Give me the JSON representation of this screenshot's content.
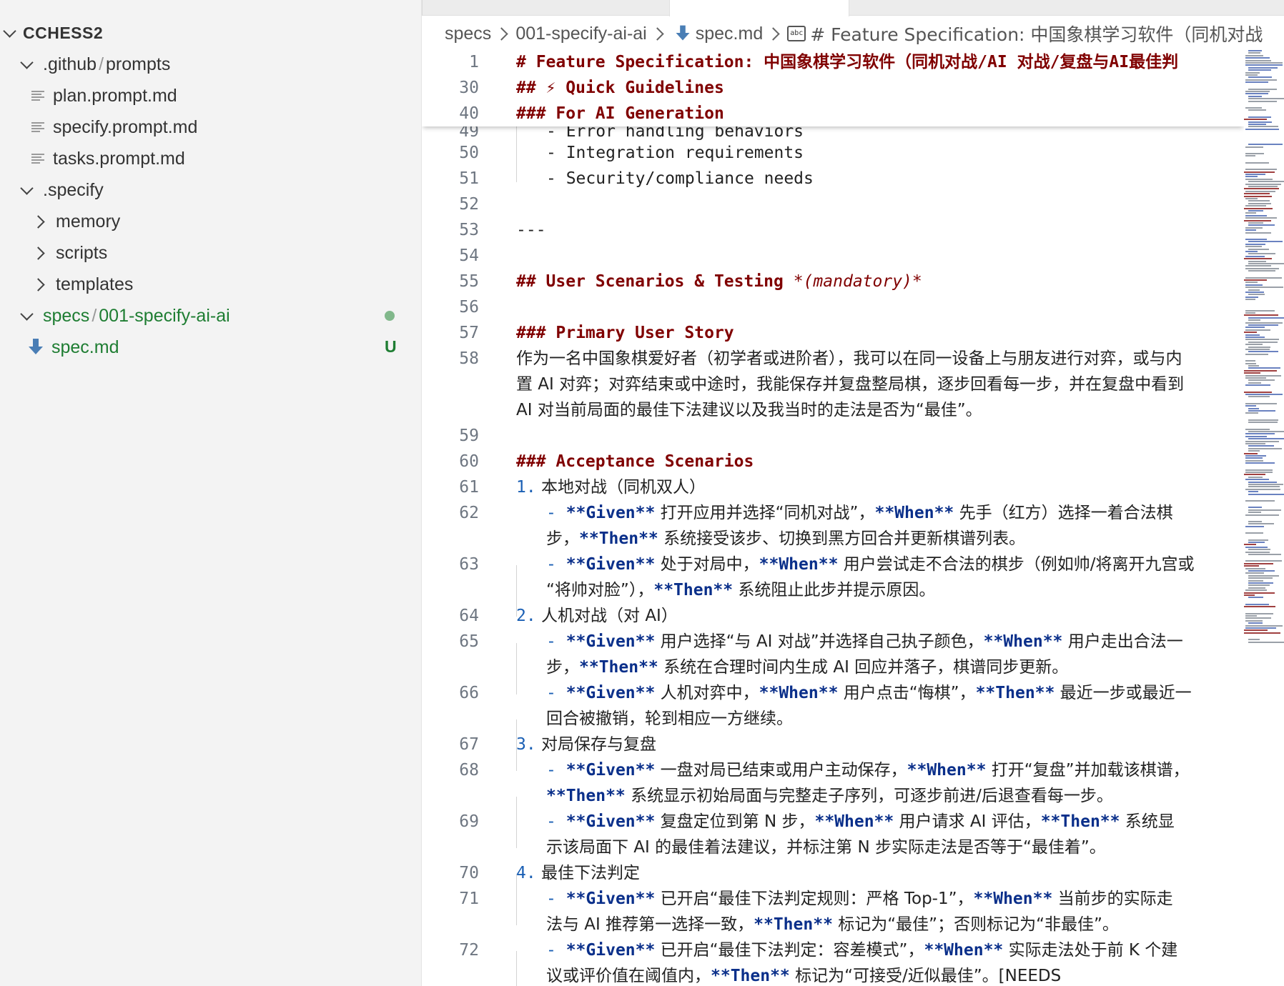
{
  "explorer": {
    "root": "CCHESS2",
    "items": [
      {
        "label": ".github",
        "sep": "/",
        "label2": "prompts"
      },
      {
        "label": "plan.prompt.md"
      },
      {
        "label": "specify.prompt.md"
      },
      {
        "label": "tasks.prompt.md"
      },
      {
        "label": ".specify"
      },
      {
        "label": "memory"
      },
      {
        "label": "scripts"
      },
      {
        "label": "templates"
      },
      {
        "label": "specs",
        "sep": "/",
        "label2": "001-specify-ai-ai"
      },
      {
        "label": "spec.md",
        "badge": "U"
      }
    ]
  },
  "breadcrumb": {
    "p1": "specs",
    "p2": "001-specify-ai-ai",
    "p3": "spec.md",
    "p4_icon_text": "abc",
    "p4": "# Feature Specification: 中国象棋学习软件（同机对战"
  },
  "sticky": [
    {
      "n": "1",
      "t": "# Feature Specification: 中国象棋学习软件（同机对战/AI 对战/复盘与AI最佳判"
    },
    {
      "n": "30",
      "a": "## ",
      "b": "⚡",
      "c": " Quick Guidelines"
    },
    {
      "n": "40",
      "t": "### For AI Generation"
    }
  ],
  "lines": {
    "l49": {
      "n": "49",
      "t": "- Error handling behaviors"
    },
    "l50": {
      "n": "50",
      "t": "- Integration requirements"
    },
    "l51": {
      "n": "51",
      "t": "- Security/compliance needs"
    },
    "l52": {
      "n": "52"
    },
    "l53": {
      "n": "53",
      "t": "---"
    },
    "l54": {
      "n": "54"
    },
    "l55": {
      "n": "55",
      "h": "## User Scenarios & Testing ",
      "it": "*(mandatory)*"
    },
    "l56": {
      "n": "56"
    },
    "l57": {
      "n": "57",
      "h": "### Primary User Story"
    },
    "l58": {
      "n": "58",
      "w1": "作为一名中国象棋爱好者（初学者或进阶者），我可以在同一设备上与朋友进行对弈，或与内",
      "w2": "置 AI 对弈；对弈结束或中途时，我能保存并复盘整局棋，逐步回看每一步，并在复盘中看到",
      "w3": "AI 对当前局面的最佳下法建议以及我当时的走法是否为“最佳”。"
    },
    "l59": {
      "n": "59"
    },
    "l60": {
      "n": "60",
      "h": "### Acceptance Scenarios"
    },
    "l61": {
      "n": "61",
      "num": "1.",
      "t": " 本地对战（同机双人）"
    },
    "l62": {
      "n": "62",
      "g": "**Given**",
      "a": " 打开应用并选择“同机对战”，",
      "w": "**When**",
      "b": " 先手（红方）选择一着合法棋",
      "c": "步，",
      "th": "**Then**",
      "d": " 系统接受该步、切换到黑方回合并更新棋谱列表。"
    },
    "l63": {
      "n": "63",
      "g": "**Given**",
      "a": " 处于对局中，",
      "w": "**When**",
      "b": " 用户尝试走不合法的棋步（例如帅/将离开九宫或",
      "c": "“将帅对脸”），",
      "th": "**Then**",
      "d": " 系统阻止此步并提示原因。"
    },
    "l64": {
      "n": "64",
      "num": "2.",
      "t": " 人机对战（对 AI）"
    },
    "l65": {
      "n": "65",
      "g": "**Given**",
      "a": " 用户选择“与 AI 对战”并选择自己执子颜色，",
      "w": "**When**",
      "b": " 用户走出合法一",
      "c": "步，",
      "th": "**Then**",
      "d": " 系统在合理时间内生成 AI 回应并落子，棋谱同步更新。"
    },
    "l66": {
      "n": "66",
      "g": "**Given**",
      "a": " 人机对弈中，",
      "w": "**When**",
      "b": " 用户点击“悔棋”，",
      "th": "**Then**",
      "d": " 最近一步或最近一",
      "c": "回合被撤销，轮到相应一方继续。"
    },
    "l67": {
      "n": "67",
      "num": "3.",
      "t": " 对局保存与复盘"
    },
    "l68": {
      "n": "68",
      "g": "**Given**",
      "a": " 一盘对局已结束或用户主动保存，",
      "w": "**When**",
      "b": " 打开“复盘”并加载该棋谱，",
      "th": "**Then**",
      "d": " 系统显示初始局面与完整走子序列，可逐步前进/后退查看每一步。"
    },
    "l69": {
      "n": "69",
      "g": "**Given**",
      "a": " 复盘定位到第 N 步，",
      "w": "**When**",
      "b": " 用户请求 AI 评估，",
      "th": "**Then**",
      "d": " 系统显",
      "c": "示该局面下 AI 的最佳着法建议，并标注第 N 步实际走法是否等于“最佳着”。"
    },
    "l70": {
      "n": "70",
      "num": "4.",
      "t": " 最佳下法判定"
    },
    "l71": {
      "n": "71",
      "g": "**Given**",
      "a": " 已开启“最佳下法判定规则：严格 Top-1”，",
      "w": "**When**",
      "b": " 当前步的实际走",
      "c": "法与 AI 推荐第一选择一致，",
      "th": "**Then**",
      "d": " 标记为“最佳”；否则标记为“非最佳”。"
    },
    "l72": {
      "n": "72",
      "g": "**Given**",
      "a": " 已开启“最佳下法判定：容差模式”，",
      "w": "**When**",
      "b": " 实际走法处于前 K 个建",
      "c": "议或评价值在阈值内，",
      "th": "**Then**",
      "d": " 标记为“可接受/近似最佳”。[NEEDS"
    }
  },
  "dash": "- ",
  "colors": {
    "heading": "#800000",
    "bold": "#0a2f8a",
    "list_number": "#1a5fb4",
    "git_untracked": "#1e7d32",
    "sidebar_bg": "#f3f3f3"
  }
}
